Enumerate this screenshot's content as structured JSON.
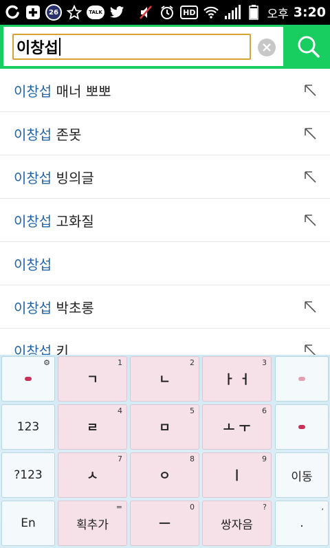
{
  "status_bar": {
    "notification_count": "26",
    "talk_label": "TALK",
    "hd_label": "HD",
    "ampm": "오후",
    "time": "3:20"
  },
  "search": {
    "query": "이창섭"
  },
  "suggestions": [
    {
      "keyword": "이창섭",
      "rest": " 매너 뽀뽀",
      "has_arrow": true
    },
    {
      "keyword": "이창섭",
      "rest": " 존못",
      "has_arrow": true
    },
    {
      "keyword": "이창섭",
      "rest": " 빙의글",
      "has_arrow": true
    },
    {
      "keyword": "이창섭",
      "rest": " 고화질",
      "has_arrow": true
    },
    {
      "keyword": "이창섭",
      "rest": "",
      "has_arrow": false
    },
    {
      "keyword": "이창섭",
      "rest": " 박초롱",
      "has_arrow": true
    },
    {
      "keyword": "이창섭",
      "rest": " 키",
      "has_arrow": true
    }
  ],
  "keyboard": {
    "row1": [
      {
        "label": "",
        "hint": "⚙",
        "style": "light",
        "name": "emoji-key"
      },
      {
        "label": "ㄱ",
        "hint": "1",
        "style": "pink",
        "name": "key-giyeok"
      },
      {
        "label": "ㄴ",
        "hint": "2",
        "style": "pink",
        "name": "key-nieun"
      },
      {
        "label": "ㅏ ㅓ",
        "hint": "3",
        "style": "pink",
        "name": "key-a-eo"
      },
      {
        "label": "",
        "hint": "",
        "style": "light",
        "name": "delete-key"
      }
    ],
    "row2": [
      {
        "label": "123",
        "hint": "",
        "style": "light",
        "name": "key-123"
      },
      {
        "label": "ㄹ",
        "hint": "4",
        "style": "pink",
        "name": "key-rieul"
      },
      {
        "label": "ㅁ",
        "hint": "5",
        "style": "pink",
        "name": "key-mieum"
      },
      {
        "label": "ㅗ ㅜ",
        "hint": "6",
        "style": "pink",
        "name": "key-o-u"
      },
      {
        "label": "",
        "hint": "",
        "style": "light",
        "name": "enter-key"
      }
    ],
    "row3": [
      {
        "label": "?123",
        "hint": "",
        "style": "light",
        "name": "key-symbols"
      },
      {
        "label": "ㅅ",
        "hint": "7",
        "style": "pink",
        "name": "key-siot"
      },
      {
        "label": "ㅇ",
        "hint": "8",
        "style": "pink",
        "name": "key-ieung"
      },
      {
        "label": "ㅣ",
        "hint": "9",
        "style": "pink",
        "name": "key-i"
      },
      {
        "label": "이동",
        "hint": "",
        "style": "light",
        "name": "key-move"
      }
    ],
    "row4": [
      {
        "label": "En",
        "hint": "",
        "style": "light",
        "name": "key-english"
      },
      {
        "label": "획추가",
        "hint": "=",
        "style": "pink",
        "name": "key-add-stroke"
      },
      {
        "label": "ㅡ",
        "hint": "0",
        "style": "pink",
        "name": "key-eu"
      },
      {
        "label": "쌍자음",
        "hint": "?",
        "style": "pink",
        "name": "key-double-consonant"
      },
      {
        "label": ".",
        "hint": ",",
        "style": "light",
        "name": "key-period"
      }
    ]
  },
  "colors": {
    "brand_green": "#19ce60",
    "keyword_blue": "#1f63ad",
    "input_border": "#d6a332"
  }
}
